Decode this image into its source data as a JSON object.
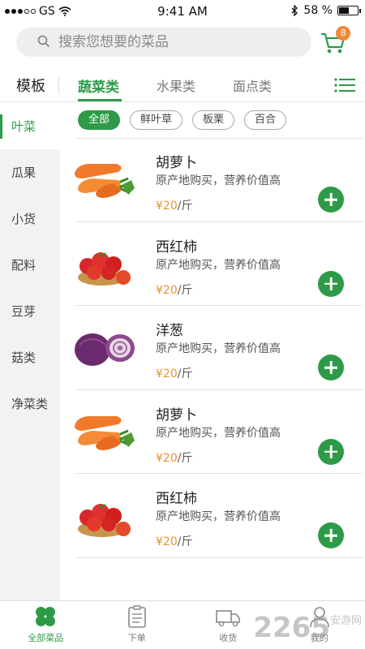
{
  "status_bar": {
    "carrier": "GS",
    "time": "9:41 AM",
    "battery": "58 %",
    "battery_level": 0.58
  },
  "search": {
    "placeholder": "搜索您想要的菜品"
  },
  "cart": {
    "badge": "8"
  },
  "category_tabs": {
    "template_label": "模板",
    "tabs": [
      "蔬菜类",
      "水果类",
      "面点类"
    ],
    "active": 0
  },
  "sidebar": {
    "items": [
      "叶菜",
      "瓜果",
      "小货",
      "配料",
      "豆芽",
      "菇类",
      "净菜类"
    ],
    "active": 0
  },
  "filters": {
    "chips": [
      "全部",
      "鲜叶草",
      "板栗",
      "百合"
    ],
    "active": 0
  },
  "products": [
    {
      "name": "胡萝卜",
      "desc": "原产地购买，营养价值高",
      "price": "¥20",
      "unit": "/斤",
      "image": "carrot"
    },
    {
      "name": "西红柿",
      "desc": "原产地购买，营养价值高",
      "price": "¥20",
      "unit": "/斤",
      "image": "tomato"
    },
    {
      "name": "洋葱",
      "desc": "原产地购买，营养价值高",
      "price": "¥20",
      "unit": "/斤",
      "image": "onion"
    },
    {
      "name": "胡萝卜",
      "desc": "原产地购买，营养价值高",
      "price": "¥20",
      "unit": "/斤",
      "image": "carrot"
    },
    {
      "name": "西红柿",
      "desc": "原产地购买，营养价值高",
      "price": "¥20",
      "unit": "/斤",
      "image": "tomato"
    }
  ],
  "bottom_nav": {
    "items": [
      "全部菜品",
      "下单",
      "收货",
      "我的"
    ],
    "active": 0
  },
  "watermark": {
    "text": "2265",
    "sub": "安游网"
  },
  "colors": {
    "accent": "#2e9a48",
    "price": "#e8912d",
    "badge": "#f0883a"
  }
}
